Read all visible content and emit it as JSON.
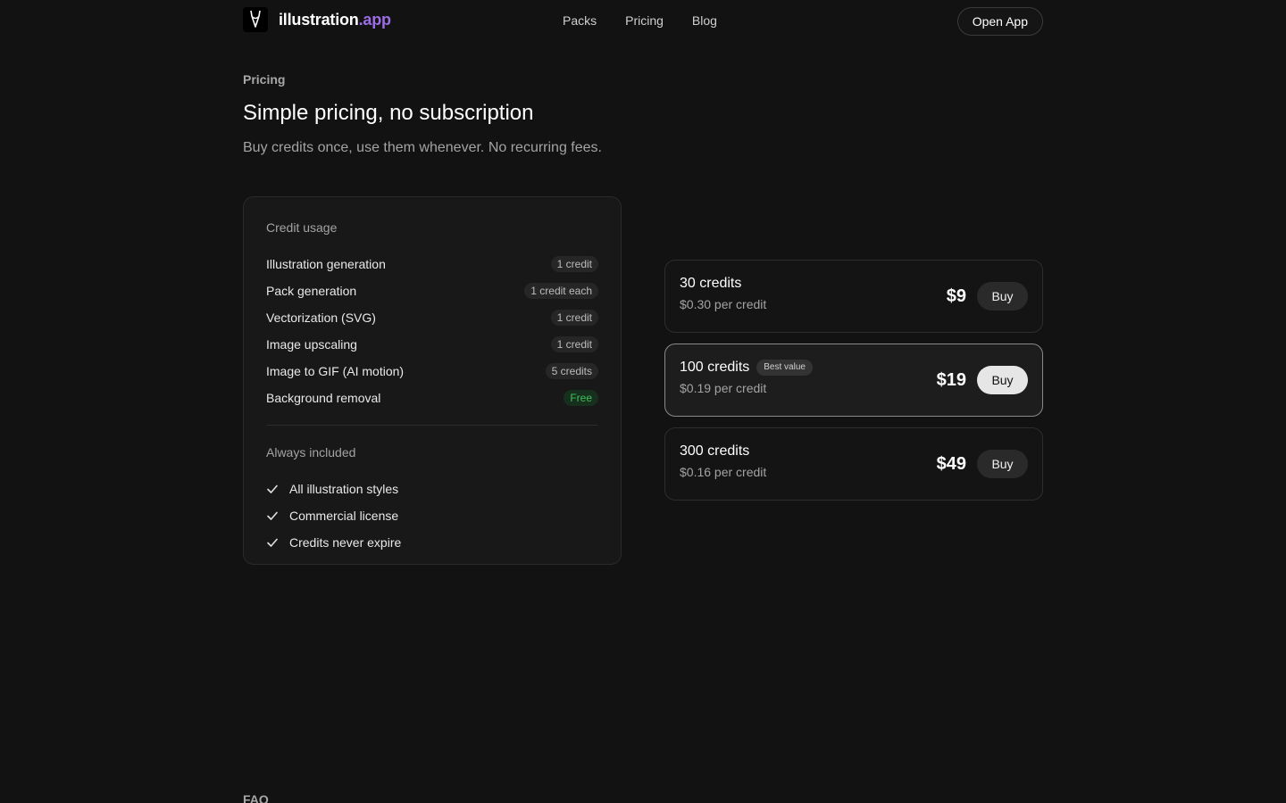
{
  "header": {
    "logo_text_main": "illustration",
    "logo_text_accent": ".app",
    "nav": [
      "Packs",
      "Pricing",
      "Blog"
    ],
    "open_app": "Open App"
  },
  "hero": {
    "eyebrow": "Pricing",
    "title": "Simple pricing, no subscription",
    "subtitle": "Buy credits once, use them whenever. No recurring fees."
  },
  "usage": {
    "label": "Credit usage",
    "items": [
      {
        "name": "Illustration generation",
        "cost": "1 credit"
      },
      {
        "name": "Pack generation",
        "cost": "1 credit each"
      },
      {
        "name": "Vectorization (SVG)",
        "cost": "1 credit"
      },
      {
        "name": "Image upscaling",
        "cost": "1 credit"
      },
      {
        "name": "Image to GIF (AI motion)",
        "cost": "5 credits"
      },
      {
        "name": "Background removal",
        "cost": "Free"
      }
    ],
    "included_label": "Always included",
    "included": [
      "All illustration styles",
      "Commercial license",
      "Credits never expire"
    ]
  },
  "packs": [
    {
      "credits": "30 credits",
      "per": "$0.30 per credit",
      "price": "$9",
      "buy": "Buy",
      "badge": ""
    },
    {
      "credits": "100 credits",
      "per": "$0.19 per credit",
      "price": "$19",
      "buy": "Buy",
      "badge": "Best value"
    },
    {
      "credits": "300 credits",
      "per": "$0.16 per credit",
      "price": "$49",
      "buy": "Buy",
      "badge": ""
    }
  ],
  "faq_label": "FAQ",
  "colors": {
    "background": "#121212",
    "accent": "#9b6ee6",
    "free": "#3fbf5a"
  }
}
